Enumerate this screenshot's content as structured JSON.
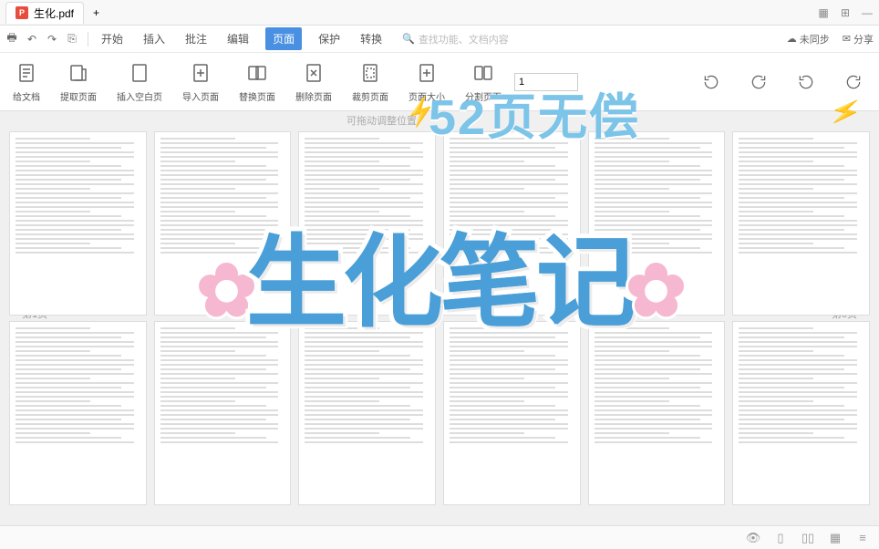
{
  "titlebar": {
    "tab_name": "生化.pdf",
    "pdf_badge": "P"
  },
  "menubar": {
    "items": [
      "开始",
      "插入",
      "批注",
      "编辑",
      "页面",
      "保护",
      "转换"
    ],
    "active_index": 4,
    "search_placeholder": "查找功能、文档内容",
    "sync": "未同步",
    "share": "分享"
  },
  "toolbar": {
    "btns": [
      {
        "label": "给文档",
        "icon": "doc"
      },
      {
        "label": "提取页面",
        "icon": "extract"
      },
      {
        "label": "插入空白页",
        "icon": "blank"
      },
      {
        "label": "导入页面",
        "icon": "import"
      },
      {
        "label": "替换页面",
        "icon": "replace"
      },
      {
        "label": "删除页面",
        "icon": "delete"
      },
      {
        "label": "裁剪页面",
        "icon": "crop"
      },
      {
        "label": "页面大小",
        "icon": "size"
      },
      {
        "label": "分割页面",
        "icon": "split"
      }
    ],
    "page_value": "1"
  },
  "content": {
    "hint": "可拖动调整位置",
    "page_label_left": "1页",
    "page_label_left_prefix": "第",
    "page_label_right": "第6页"
  },
  "overlay": {
    "top": "52页无偿",
    "main": "生化笔记",
    "flower": "✿",
    "bolt": "⚡"
  }
}
